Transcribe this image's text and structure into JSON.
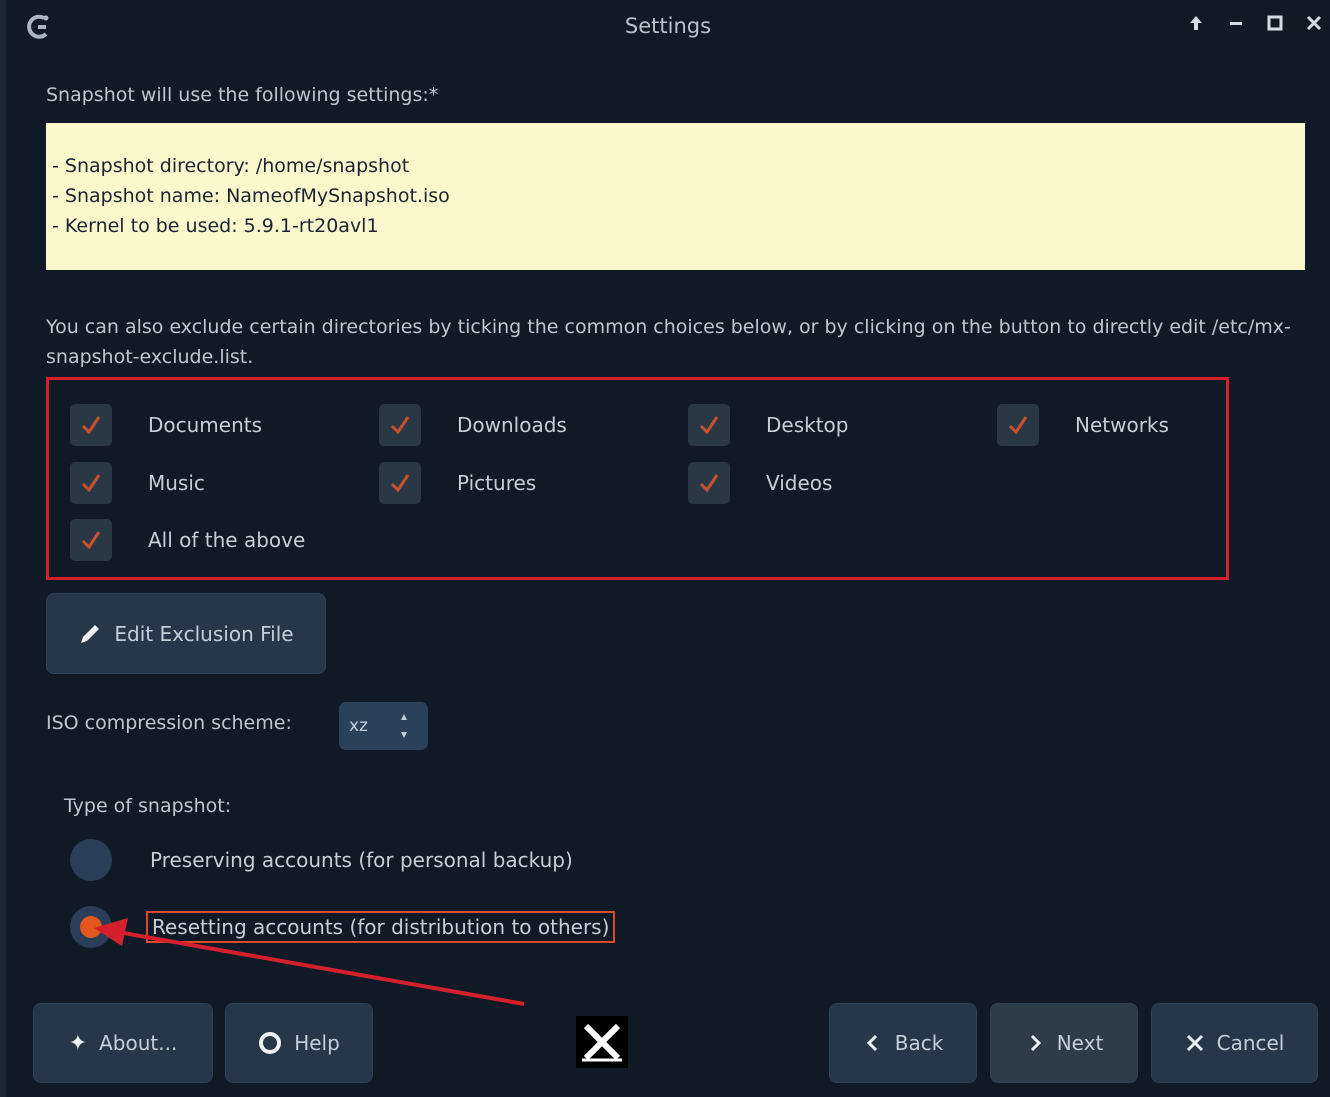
{
  "window": {
    "title": "Settings",
    "controls": [
      "keep-above",
      "minimize",
      "maximize",
      "close"
    ]
  },
  "intro": "Snapshot will use the following settings:*",
  "settings": [
    "- Snapshot directory: /home/snapshot",
    "- Snapshot name: NameofMySnapshot.iso",
    "- Kernel to be used: 5.9.1-rt20avl1"
  ],
  "exclude_text": "You can also exclude certain directories by ticking the common choices below, or by clicking on the button to directly edit /etc/mx-snapshot-exclude.list.",
  "excludes": [
    {
      "label": "Documents",
      "checked": true
    },
    {
      "label": "Downloads",
      "checked": true
    },
    {
      "label": "Desktop",
      "checked": true
    },
    {
      "label": "Networks",
      "checked": true
    },
    {
      "label": "Music",
      "checked": true
    },
    {
      "label": "Pictures",
      "checked": true
    },
    {
      "label": "Videos",
      "checked": true
    },
    {
      "label": "All of the above",
      "checked": true
    }
  ],
  "edit_button": "Edit Exclusion File",
  "iso": {
    "label": "ISO compression scheme:",
    "value": "xz"
  },
  "snapshot_type": {
    "label": "Type of snapshot:",
    "options": [
      {
        "label": "Preserving accounts (for personal backup)",
        "selected": false
      },
      {
        "label": "Resetting accounts (for distribution to others)",
        "selected": true
      }
    ]
  },
  "buttons": {
    "about": "About...",
    "help": "Help",
    "back": "Back",
    "next": "Next",
    "cancel": "Cancel"
  },
  "colors": {
    "background": "#101a26",
    "highlight_box": "#fbf8cd",
    "annotation_red": "#d4202c",
    "radio_selected": "#e5561e",
    "checkmark": "#c8502b"
  },
  "icons": {
    "app": "mx-snapshot-icon",
    "edit": "pencil-icon",
    "about": "sparkle-icon",
    "help": "lifebuoy-icon",
    "back": "chevron-left-icon",
    "next": "chevron-right-icon",
    "cancel": "x-icon"
  }
}
